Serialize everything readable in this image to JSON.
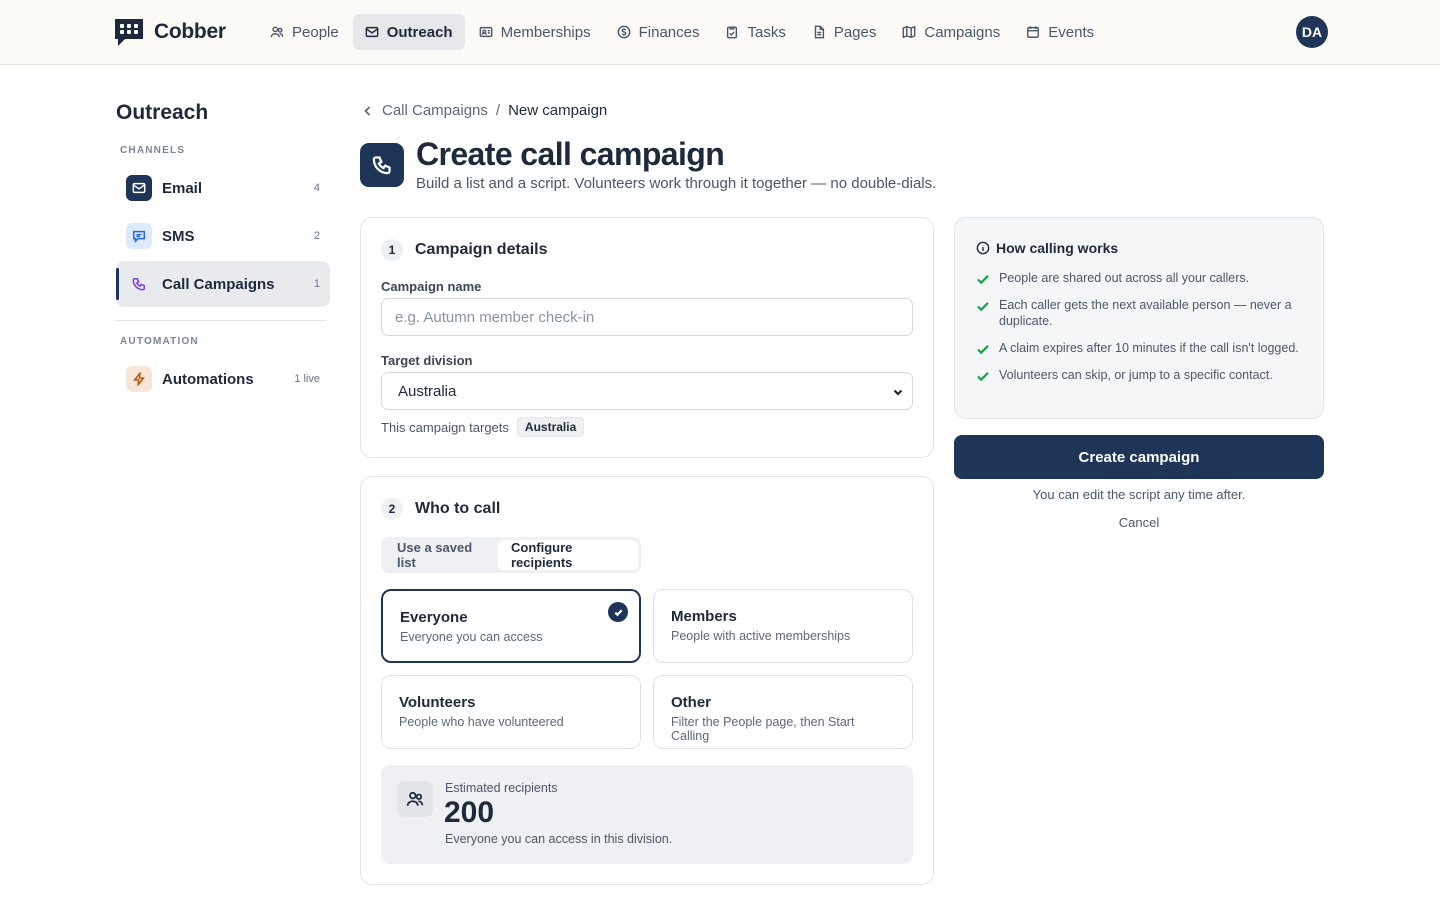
{
  "app": {
    "name": "Cobber",
    "user_initials": "DA"
  },
  "nav": {
    "items": [
      {
        "label": "People",
        "icon": "people-icon"
      },
      {
        "label": "Outreach",
        "icon": "mail-icon",
        "active": true
      },
      {
        "label": "Memberships",
        "icon": "id-card-icon"
      },
      {
        "label": "Finances",
        "icon": "dollar-icon"
      },
      {
        "label": "Tasks",
        "icon": "clipboard-icon"
      },
      {
        "label": "Pages",
        "icon": "document-icon"
      },
      {
        "label": "Campaigns",
        "icon": "map-icon"
      },
      {
        "label": "Events",
        "icon": "calendar-icon"
      }
    ]
  },
  "sidebar": {
    "title": "Outreach",
    "channels_label": "CHANNELS",
    "automation_label": "AUTOMATION",
    "items": [
      {
        "label": "Email",
        "count": "4",
        "icon": "mail-icon"
      },
      {
        "label": "SMS",
        "count": "2",
        "icon": "chat-icon"
      },
      {
        "label": "Call Campaigns",
        "count": "1",
        "icon": "phone-icon",
        "active": true
      },
      {
        "label": "Automations",
        "count": "1 live",
        "icon": "bolt-icon"
      }
    ]
  },
  "header": {
    "breadcrumb_parent": "Call Campaigns",
    "breadcrumb_sep": "/",
    "breadcrumb_current": "New campaign",
    "title": "Create call campaign",
    "subtitle": "Build a list and a script. Volunteers work through it together — no double-dials."
  },
  "details": {
    "step": "1",
    "title": "Campaign details",
    "name_label": "Campaign name",
    "name_value": "",
    "name_placeholder": "e.g. Autumn member check-in",
    "division_label": "Target division",
    "division_value": "Australia",
    "targets_text": "This campaign targets",
    "targets_tag": "Australia"
  },
  "who": {
    "step": "2",
    "title": "Who to call",
    "tabs": [
      {
        "label": "Use a saved list",
        "active": false
      },
      {
        "label": "Configure recipients",
        "active": true
      }
    ],
    "options": [
      {
        "title": "Everyone",
        "desc": "Everyone you can access",
        "selected": true
      },
      {
        "title": "Members",
        "desc": "People with active memberships",
        "selected": false
      },
      {
        "title": "Volunteers",
        "desc": "People who have volunteered",
        "selected": false
      },
      {
        "title": "Other",
        "desc": "Filter the People page, then Start Calling",
        "selected": false
      }
    ],
    "estimate_label": "Estimated recipients",
    "estimate_value": "200",
    "estimate_note": "Everyone you can access in this division."
  },
  "how": {
    "title": "How calling works",
    "items": [
      "People are shared out across all your callers.",
      "Each caller gets the next available person — never a duplicate.",
      "A claim expires after 10 minutes if the call isn't logged.",
      "Volunteers can skip, or jump to a specific contact."
    ]
  },
  "actions": {
    "create_label": "Create campaign",
    "edit_note": "You can edit the script any time after.",
    "cancel_label": "Cancel"
  },
  "colors": {
    "primary": "#1f3557",
    "check": "#16a34a",
    "call_accent": "#7c3aed",
    "sms_accent": "#2563eb",
    "bolt_accent": "#b45309"
  }
}
